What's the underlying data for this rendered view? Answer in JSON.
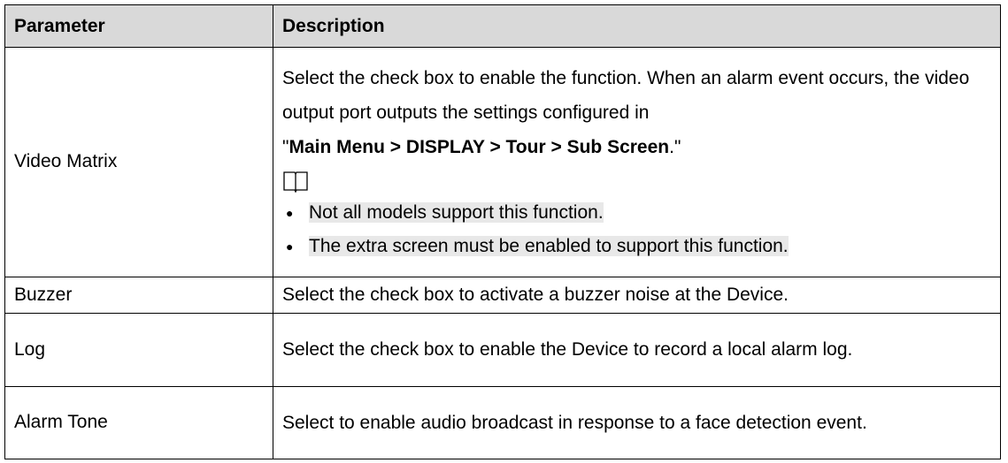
{
  "table": {
    "headers": {
      "parameter": "Parameter",
      "description": "Description"
    },
    "rows": [
      {
        "parameter": "Video Matrix",
        "description": "Select the check box to enable the function. When an alarm event occurs, the video output port outputs the settings configured in",
        "menu_path": {
          "open_quote": "\"",
          "path": "Main Menu > DISPLAY > Tour > Sub Screen",
          "close": ".\""
        },
        "notes": [
          "Not all models support this function.",
          "The extra screen must be enabled to support this function."
        ]
      },
      {
        "parameter": "Buzzer",
        "description": "Select the check box to activate a buzzer noise at the Device."
      },
      {
        "parameter": "Log",
        "description": "Select the check box to enable the Device to record a local alarm log."
      },
      {
        "parameter": "Alarm Tone",
        "description": "Select to enable audio broadcast in response to a face detection event."
      }
    ]
  },
  "icons": {
    "note": "book-icon",
    "bullet": "●"
  }
}
